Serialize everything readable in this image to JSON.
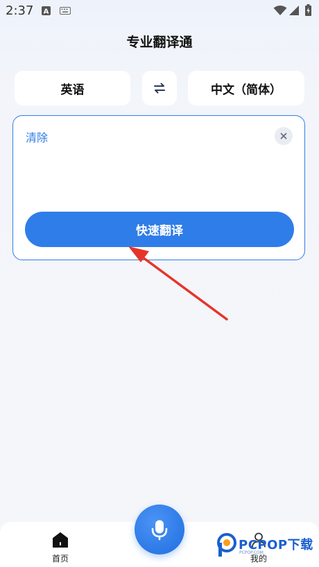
{
  "status_bar": {
    "time": "2:37",
    "icons": [
      "a-text-icon",
      "keyboard-icon",
      "wifi-icon",
      "signal-icon",
      "battery-icon"
    ]
  },
  "header": {
    "title": "专业翻译通"
  },
  "lang_bar": {
    "source": "英语",
    "target": "中文（简体）",
    "swap_icon": "swap-icon"
  },
  "input_card": {
    "clear_label": "清除",
    "close_icon": "close-icon",
    "translate_label": "快速翻译"
  },
  "bottom_nav": {
    "home_label": "首页",
    "mine_label": "我的",
    "mic_icon": "microphone-icon"
  },
  "watermark": {
    "text": "PCPOP下载",
    "sub": "PCPOP.COM"
  },
  "colors": {
    "accent": "#2f7de8",
    "annotation_arrow": "#e8332a"
  }
}
